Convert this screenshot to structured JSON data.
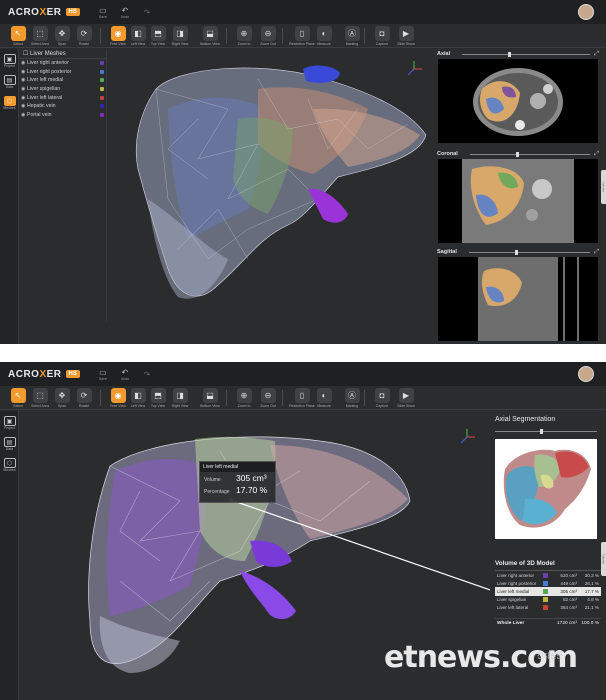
{
  "app": {
    "logo_a": "ACRO",
    "logo_x": "X",
    "logo_b": "ER",
    "badge": "HS"
  },
  "topbar_icons": [
    {
      "label": "Save",
      "icon": "save-icon"
    },
    {
      "label": "Undo",
      "icon": "undo-icon"
    },
    {
      "label": "",
      "icon": "redo-icon"
    }
  ],
  "toolbar": [
    {
      "label": "Select",
      "icon": "cursor-icon",
      "active": true
    },
    {
      "label": "Select Area",
      "icon": "select-area-icon"
    },
    {
      "label": "Span",
      "icon": "pan-icon"
    },
    {
      "label": "Rotate",
      "icon": "rotate-icon"
    },
    {
      "label": "Free View",
      "icon": "free-view-icon",
      "active": true
    },
    {
      "label": "Left View",
      "icon": "left-view-icon"
    },
    {
      "label": "Top View",
      "icon": "top-view-icon"
    },
    {
      "label": "Right View",
      "icon": "right-view-icon"
    },
    {
      "label": "Bottom View",
      "icon": "bottom-view-icon"
    },
    {
      "label": "Zoom In",
      "icon": "zoom-in-icon"
    },
    {
      "label": "Zoom Out",
      "icon": "zoom-out-icon"
    },
    {
      "label": "Resection Plane",
      "icon": "resection-plane-icon"
    },
    {
      "label": "Measure",
      "icon": "measure-icon"
    },
    {
      "label": "Marking",
      "icon": "marking-icon"
    },
    {
      "label": "Capture",
      "icon": "camera-icon"
    },
    {
      "label": "Slide Show",
      "icon": "slideshow-icon"
    }
  ],
  "sidebar": [
    {
      "label": "Project",
      "icon": "folder-icon"
    },
    {
      "label": "Data",
      "icon": "data-icon"
    },
    {
      "label": "Meshes",
      "icon": "cube-icon",
      "active_top": true
    }
  ],
  "meshes": {
    "title": "Liver Meshes",
    "items": [
      {
        "label": "Liver right anterior",
        "color": "#6a3fa8"
      },
      {
        "label": "Liver right posterior",
        "color": "#4a7ad8"
      },
      {
        "label": "Liver left medial",
        "color": "#58a858"
      },
      {
        "label": "Liver spigelian",
        "color": "#b8b840"
      },
      {
        "label": "Liver left lateral",
        "color": "#c0443a"
      },
      {
        "label": "Hepatic vein",
        "color": "#2a2ab0"
      },
      {
        "label": "Portal vein",
        "color": "#8a2ab8"
      }
    ]
  },
  "slices": {
    "axial": "Axial",
    "coronal": "Coronal",
    "sagittal": "Sagittal"
  },
  "dock_label": "Volume",
  "axial_segmentation": {
    "title": "Axial Segmentation"
  },
  "volume": {
    "title": "Volume of 3D Model",
    "rows": [
      {
        "label": "Liver right anterior",
        "color": "#6a3fa8",
        "value": "520 cm³",
        "percent": "30.3 %"
      },
      {
        "label": "Liver right posterior",
        "color": "#4a7ad8",
        "value": "449 cm³",
        "percent": "26.1 %"
      },
      {
        "label": "Liver left medial",
        "color": "#58a858",
        "value": "305 cm³",
        "percent": "17.7 %",
        "selected": true
      },
      {
        "label": "Liver spigelian",
        "color": "#b8b840",
        "value": "82 cm³",
        "percent": "4.8 %"
      },
      {
        "label": "Liver left lateral",
        "color": "#c0443a",
        "value": "364 cm³",
        "percent": "21.1 %"
      }
    ],
    "total_label": "Whole Liver",
    "total_value": "1720 cm³",
    "total_percent": "100.0 %"
  },
  "tooltip": {
    "title": "Liver left medial",
    "volume_label": "Volume",
    "volume_value": "305 cm³",
    "percentage_label": "Percentage",
    "percentage_value": "17.70 %"
  },
  "watermark": {
    "brand": "etnews.com",
    "sub": "전자신문"
  }
}
